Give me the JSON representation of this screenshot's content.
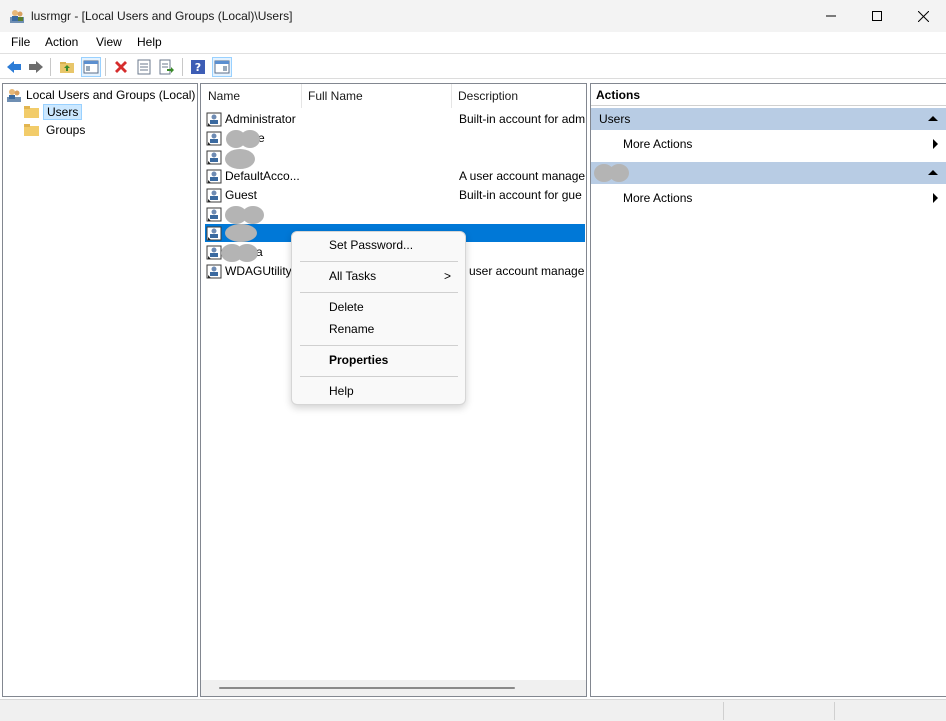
{
  "window": {
    "title": "lusrmgr - [Local Users and Groups (Local)\\Users]",
    "minimize_glyph": "—",
    "close_glyph": "✕"
  },
  "menu": {
    "items": [
      "File",
      "Action",
      "View",
      "Help"
    ]
  },
  "toolbar": {
    "icons": [
      "back-icon",
      "forward-icon",
      "up-folder-icon",
      "show-hide-tree-icon",
      "delete-icon",
      "properties-icon",
      "export-list-icon",
      "help-icon",
      "show-hide-action-pane-icon"
    ]
  },
  "tree": {
    "root": "Local Users and Groups (Local)",
    "children": [
      "Users",
      "Groups"
    ],
    "selected": "Users"
  },
  "list": {
    "columns": [
      "Name",
      "Full Name",
      "Description"
    ],
    "rows": [
      {
        "name": "Administrator",
        "full_name": "",
        "description": "Built-in account for adm"
      },
      {
        "name": "e",
        "full_name": "",
        "description": ""
      },
      {
        "name": "",
        "full_name": "",
        "description": ""
      },
      {
        "name": "DefaultAcco...",
        "full_name": "",
        "description": "A user account manage"
      },
      {
        "name": "Guest",
        "full_name": "",
        "description": "Built-in account for gue"
      },
      {
        "name": "",
        "full_name": "",
        "description": ""
      },
      {
        "name": "",
        "full_name": "",
        "description": ""
      },
      {
        "name": "a",
        "full_name": "",
        "description": ""
      },
      {
        "name": "WDAGUtility",
        "full_name": "",
        "description": "user account manage"
      }
    ],
    "selected_row_index": 6
  },
  "actions": {
    "header": "Actions",
    "group1": "Users",
    "group1_item": "More Actions",
    "group2": "",
    "group2_item": "More Actions"
  },
  "context_menu": {
    "set_password": "Set Password...",
    "all_tasks": "All Tasks",
    "all_tasks_arrow": ">",
    "delete": "Delete",
    "rename": "Rename",
    "properties": "Properties",
    "help": "Help"
  },
  "colors": {
    "selection": "#0078d7",
    "action_group": "#b8cce4",
    "tree_selection": "#cce8ff"
  }
}
